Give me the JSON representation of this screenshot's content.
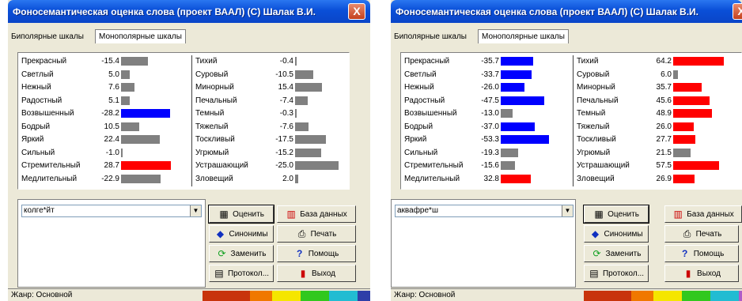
{
  "windows": [
    {
      "title": "Фоносемантическая оценка слова  (проект ВААЛ)  (C)  Шалак В.И.",
      "close_label": "X",
      "tabs": [
        "Биполярные шкалы",
        "Монополярные шкалы"
      ],
      "left_column": [
        {
          "label": "Прекрасный",
          "value": "-15.4",
          "num": -15.4,
          "color": "#808080"
        },
        {
          "label": "Светлый",
          "value": "5.0",
          "num": 5.0,
          "color": "#808080"
        },
        {
          "label": "Нежный",
          "value": "7.6",
          "num": 7.6,
          "color": "#808080"
        },
        {
          "label": "Радостный",
          "value": "5.1",
          "num": 5.1,
          "color": "#808080"
        },
        {
          "label": "Возвышенный",
          "value": "-28.2",
          "num": -28.2,
          "color": "#0000ff"
        },
        {
          "label": "Бодрый",
          "value": "10.5",
          "num": 10.5,
          "color": "#808080"
        },
        {
          "label": "Яркий",
          "value": "22.4",
          "num": 22.4,
          "color": "#808080"
        },
        {
          "label": "Сильный",
          "value": "-1.0",
          "num": -1.0,
          "color": "#808080"
        },
        {
          "label": "Стремительный",
          "value": "28.7",
          "num": 28.7,
          "color": "#ff0000"
        },
        {
          "label": "Медлительный",
          "value": "-22.9",
          "num": -22.9,
          "color": "#808080"
        }
      ],
      "right_column": [
        {
          "label": "Тихий",
          "value": "-0.4",
          "num": -0.4,
          "color": "#808080"
        },
        {
          "label": "Суровый",
          "value": "-10.5",
          "num": -10.5,
          "color": "#808080"
        },
        {
          "label": "Минорный",
          "value": "15.4",
          "num": 15.4,
          "color": "#808080"
        },
        {
          "label": "Печальный",
          "value": "-7.4",
          "num": -7.4,
          "color": "#808080"
        },
        {
          "label": "Темный",
          "value": "-0.3",
          "num": -0.3,
          "color": "#808080"
        },
        {
          "label": "Тяжелый",
          "value": "-7.6",
          "num": -7.6,
          "color": "#808080"
        },
        {
          "label": "Тоскливый",
          "value": "-17.5",
          "num": -17.5,
          "color": "#808080"
        },
        {
          "label": "Угрюмый",
          "value": "-15.2",
          "num": -15.2,
          "color": "#808080"
        },
        {
          "label": "Устрашающий",
          "value": "-25.0",
          "num": -25.0,
          "color": "#808080"
        },
        {
          "label": "Зловещий",
          "value": "2.0",
          "num": 2.0,
          "color": "#808080"
        }
      ],
      "word": "колге*йт",
      "buttons": {
        "evaluate": "Оценить",
        "database": "База данных",
        "synonyms": "Синонимы",
        "print": "Печать",
        "replace": "Заменить",
        "help": "Помощь",
        "protocol": "Протокол...",
        "exit": "Выход"
      },
      "status": "Жанр: Основной",
      "swatches": [
        "#c8340c",
        "#f07800",
        "#f5e600",
        "#31c81e",
        "#22bcd2",
        "#2e3ea8"
      ]
    },
    {
      "title": "Фоносемантическая оценка слова  (проект ВААЛ)  (C)  Шалак В.И.",
      "close_label": "X",
      "tabs": [
        "Биполярные шкалы",
        "Монополярные шкалы"
      ],
      "left_column": [
        {
          "label": "Прекрасный",
          "value": "-35.7",
          "num": -35.7,
          "color": "#0000ff"
        },
        {
          "label": "Светлый",
          "value": "-33.7",
          "num": -33.7,
          "color": "#0000ff"
        },
        {
          "label": "Нежный",
          "value": "-26.0",
          "num": -26.0,
          "color": "#0000ff"
        },
        {
          "label": "Радостный",
          "value": "-47.5",
          "num": -47.5,
          "color": "#0000ff"
        },
        {
          "label": "Возвышенный",
          "value": "-13.0",
          "num": -13.0,
          "color": "#808080"
        },
        {
          "label": "Бодрый",
          "value": "-37.0",
          "num": -37.0,
          "color": "#0000ff"
        },
        {
          "label": "Яркий",
          "value": "-53.3",
          "num": -53.3,
          "color": "#0000ff"
        },
        {
          "label": "Сильный",
          "value": "-19.3",
          "num": -19.3,
          "color": "#808080"
        },
        {
          "label": "Стремительный",
          "value": "-15.6",
          "num": -15.6,
          "color": "#808080"
        },
        {
          "label": "Медлительный",
          "value": "32.8",
          "num": 32.8,
          "color": "#ff0000"
        }
      ],
      "right_column": [
        {
          "label": "Тихий",
          "value": "64.2",
          "num": 64.2,
          "color": "#ff0000"
        },
        {
          "label": "Суровый",
          "value": "6.0",
          "num": 6.0,
          "color": "#808080"
        },
        {
          "label": "Минорный",
          "value": "35.7",
          "num": 35.7,
          "color": "#ff0000"
        },
        {
          "label": "Печальный",
          "value": "45.6",
          "num": 45.6,
          "color": "#ff0000"
        },
        {
          "label": "Темный",
          "value": "48.9",
          "num": 48.9,
          "color": "#ff0000"
        },
        {
          "label": "Тяжелый",
          "value": "26.0",
          "num": 26.0,
          "color": "#ff0000"
        },
        {
          "label": "Тоскливый",
          "value": "27.7",
          "num": 27.7,
          "color": "#ff0000"
        },
        {
          "label": "Угрюмый",
          "value": "21.5",
          "num": 21.5,
          "color": "#808080"
        },
        {
          "label": "Устрашающий",
          "value": "57.5",
          "num": 57.5,
          "color": "#ff0000"
        },
        {
          "label": "Зловещий",
          "value": "26.9",
          "num": 26.9,
          "color": "#ff0000"
        }
      ],
      "word": "аквафре*ш",
      "buttons": {
        "evaluate": "Оценить",
        "database": "База данных",
        "synonyms": "Синонимы",
        "print": "Печать",
        "replace": "Заменить",
        "help": "Помощь",
        "protocol": "Протокол...",
        "exit": "Выход"
      },
      "status": "Жанр: Основной",
      "swatches": [
        "#c8340c",
        "#f07800",
        "#f5e600",
        "#31c81e",
        "#22bcd2",
        "#b05cc8"
      ]
    }
  ]
}
